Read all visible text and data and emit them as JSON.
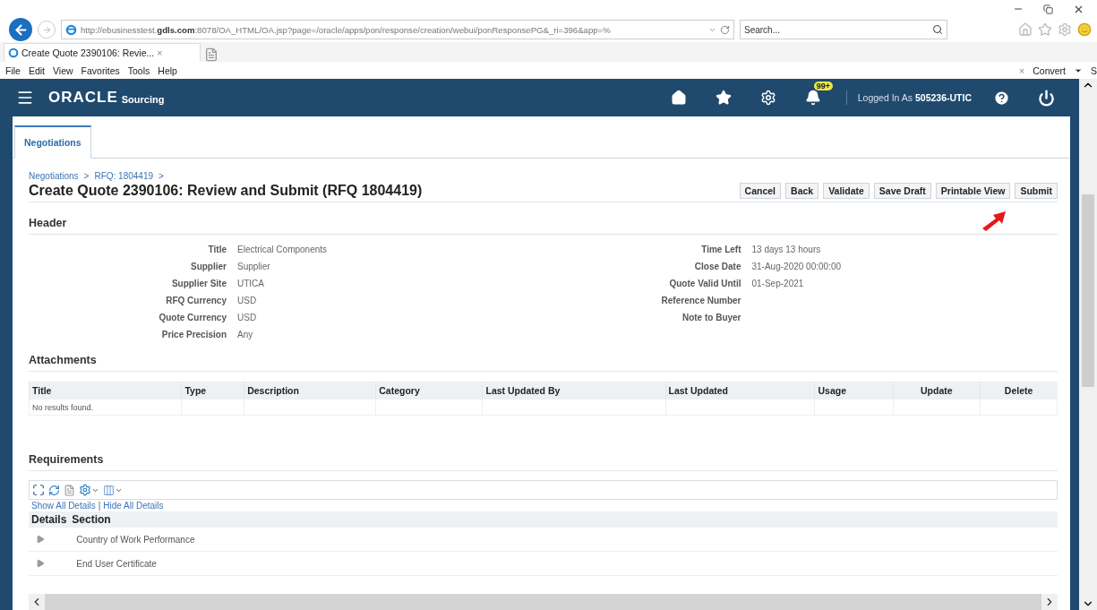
{
  "browser": {
    "address": "http://ebusinesstest.**gdls.com**:8078/OA_HTML/OA.jsp?page=/oracle/apps/pon/response/creation/webui/ponResponsePG&_ri=396&app=%",
    "search": {
      "placeholder": "Search..."
    },
    "tab": {
      "title": "Create Quote 2390106: Revie...",
      "close": "×"
    },
    "menu": [
      "File",
      "Edit",
      "View",
      "Favorites",
      "Tools",
      "Help"
    ],
    "extras": {
      "close": "×",
      "convert": "Convert",
      "cut": "S"
    }
  },
  "app": {
    "brand": "ORACLE",
    "product": "Sourcing",
    "badge": "99+",
    "user": "Logged In As **505236-UTIC**"
  },
  "tabs": [
    {
      "label": "Negotiations",
      "selected": true
    }
  ],
  "breadcrumbs": [
    "Negotiations",
    "RFQ: 1804419"
  ],
  "breadcrumb_separator": ">",
  "title": "Create Quote 2390106: Review and Submit (RFQ 1804419)",
  "buttons": [
    "Cancel",
    "Back",
    "Validate",
    "Save Draft",
    "Printable View",
    "Submit"
  ],
  "header": {
    "heading": "Header",
    "left": [
      {
        "label": "Title",
        "value": "Electrical Components"
      },
      {
        "label": "Supplier",
        "value": "Supplier"
      },
      {
        "label": "Supplier Site",
        "value": "UTICA"
      },
      {
        "label": "RFQ Currency",
        "value": "USD"
      },
      {
        "label": "Quote Currency",
        "value": "USD"
      },
      {
        "label": "Price Precision",
        "value": "Any"
      }
    ],
    "right": [
      {
        "label": "Time Left",
        "value": "13 days 13 hours"
      },
      {
        "label": "Close Date",
        "value": "31-Aug-2020 00:00:00"
      },
      {
        "label": "Quote Valid Until",
        "value": "01-Sep-2021"
      },
      {
        "label": "Reference Number"
      },
      {
        "label": "Note to Buyer"
      }
    ]
  },
  "attachments": {
    "heading": "Attachments",
    "columns": [
      "Title",
      "Type",
      "Description",
      "Category",
      "Last Updated By",
      "Last Updated",
      "Usage",
      "Update",
      "Delete"
    ],
    "empty": "No results found."
  },
  "requirements": {
    "heading": "Requirements",
    "links": [
      "Show All Details",
      "Hide All Details"
    ],
    "separator": "|",
    "columns": [
      "Details",
      "Section"
    ],
    "rows": [
      {
        "section": "Country of Work Performance",
        "expanded": false
      },
      {
        "section": "End User Certificate",
        "expanded": false
      }
    ]
  }
}
